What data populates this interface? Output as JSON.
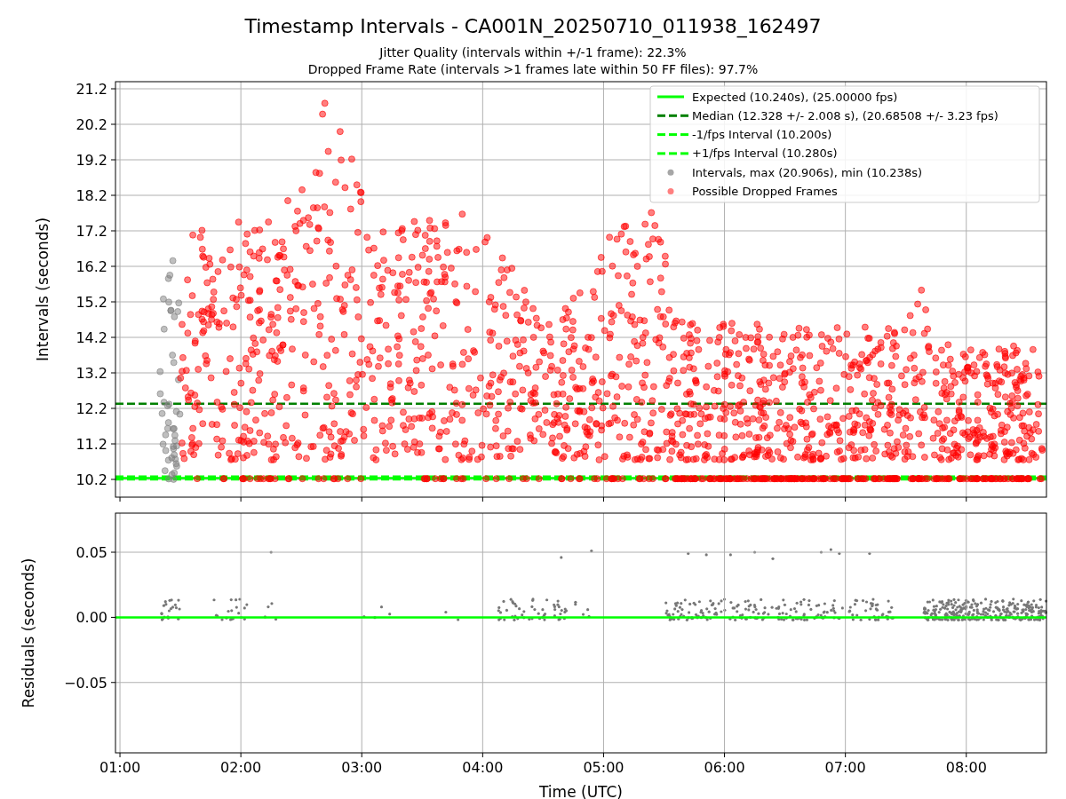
{
  "figure": {
    "title": "Timestamp Intervals - CA001N_20250710_011938_162497",
    "subtitles": [
      "Jitter Quality (intervals within +/-1 frame): 22.3%",
      "Dropped Frame Rate (intervals >1 frames late within 50 FF files): 97.7%"
    ]
  },
  "top_plot": {
    "chart_data": {
      "type": "line",
      "ylabel": "Intervals (seconds)",
      "x": [
        0.963,
        8.663
      ],
      "xlim": [
        0.963,
        8.663
      ],
      "ylim": [
        9.7,
        21.4
      ],
      "grid": true,
      "legend": "upper right",
      "yticks": [
        {
          "value": 10.2,
          "label": "10.2"
        },
        {
          "value": 11.2,
          "label": "11.2"
        },
        {
          "value": 12.2,
          "label": "12.2"
        },
        {
          "value": 13.2,
          "label": "13.2"
        },
        {
          "value": 14.2,
          "label": "14.2"
        },
        {
          "value": 15.2,
          "label": "15.2"
        },
        {
          "value": 16.2,
          "label": "16.2"
        },
        {
          "value": 17.2,
          "label": "17.2"
        },
        {
          "value": 18.2,
          "label": "18.2"
        },
        {
          "value": 19.2,
          "label": "19.2"
        },
        {
          "value": 20.2,
          "label": "20.2"
        },
        {
          "value": 21.2,
          "label": "21.2"
        }
      ],
      "series": [
        {
          "name": "Expected (10.240s), (25.00000 fps)",
          "color": "#00ff00",
          "line_style": "solid",
          "values": [
            10.24,
            10.24
          ]
        },
        {
          "name": "Median (12.328 +/- 2.008 s), (20.68508 +/- 3.23 fps)",
          "color": "#008000",
          "line_style": "dashed",
          "values": [
            12.33,
            12.33
          ]
        },
        {
          "name": "-1/fps Interval (10.200s)",
          "color": "#00ff00",
          "line_style": "dashed",
          "values": [
            10.2,
            10.2
          ]
        },
        {
          "name": "+1/fps Interval (10.280s)",
          "color": "#00ff00",
          "line_style": "dashed",
          "values": [
            10.28,
            10.28
          ]
        }
      ]
    },
    "marker_legend": [
      {
        "label": "Intervals, max (20.906s), min (10.238s)",
        "color": "#a6a6a6"
      },
      {
        "label": "Possible Dropped Frames",
        "color": "#ff7f7f"
      }
    ]
  },
  "bottom_plot": {
    "chart_data": {
      "type": "line",
      "xlabel": "Time (UTC)",
      "ylabel": "Residuals (seconds)",
      "x": [
        0.963,
        8.663
      ],
      "xlim": [
        0.963,
        8.663
      ],
      "ylim": [
        -0.104,
        0.08
      ],
      "grid": true,
      "xticks": [
        {
          "value": 1,
          "label": "01:00"
        },
        {
          "value": 2,
          "label": "02:00"
        },
        {
          "value": 3,
          "label": "03:00"
        },
        {
          "value": 4,
          "label": "04:00"
        },
        {
          "value": 5,
          "label": "05:00"
        },
        {
          "value": 6,
          "label": "06:00"
        },
        {
          "value": 7,
          "label": "07:00"
        },
        {
          "value": 8,
          "label": "08:00"
        }
      ],
      "yticks": [
        {
          "value": 0.05,
          "label": "0.05"
        },
        {
          "value": 0,
          "label": "0.00"
        },
        {
          "value": -0.05,
          "label": "−0.05"
        }
      ],
      "series": [
        {
          "color": "#00ff00",
          "line_style": "solid",
          "values": [
            0,
            0
          ]
        }
      ]
    }
  }
}
